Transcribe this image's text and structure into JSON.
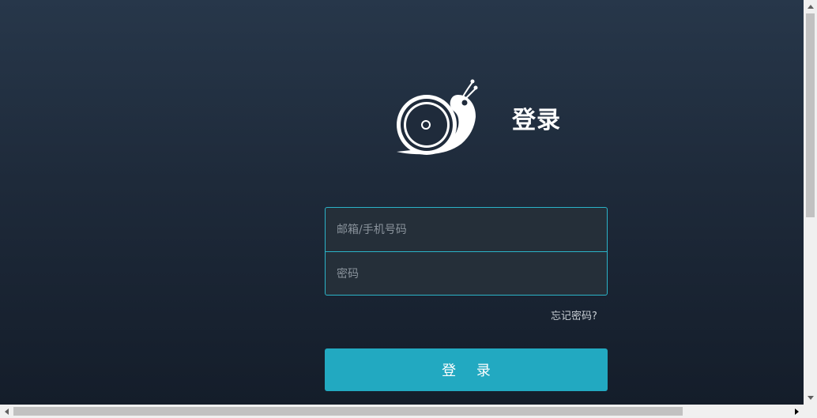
{
  "header": {
    "title": "登录",
    "logo_icon": "snail-icon"
  },
  "form": {
    "account_placeholder": "邮箱/手机号码",
    "account_value": "",
    "password_placeholder": "密码",
    "password_value": "",
    "forgot_password_label": "忘记密码?",
    "login_button_label": "登 录"
  },
  "colors": {
    "accent": "#22a9c1",
    "input_border": "#2bb3c8",
    "background_top": "#27374a",
    "background_bottom": "#141d2a"
  }
}
